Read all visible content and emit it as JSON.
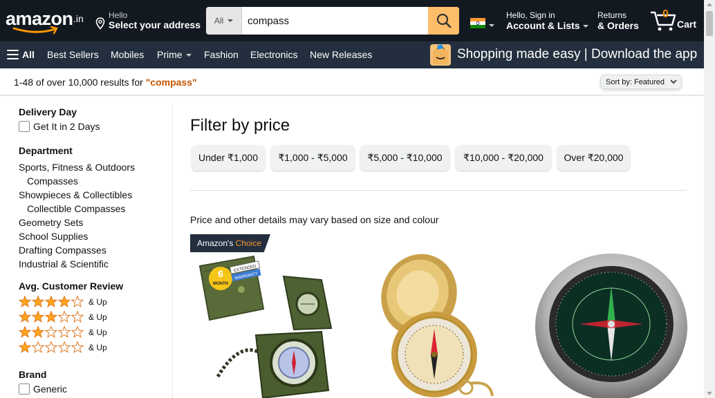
{
  "header": {
    "logo_text": "amazon",
    "logo_suffix": ".in",
    "address_hello": "Hello",
    "address_select": "Select your address",
    "search_category": "All",
    "search_value": "compass",
    "account_hello": "Hello, Sign in",
    "account_lists": "Account & Lists",
    "returns_line1": "Returns",
    "returns_line2": "& Orders",
    "cart_count": "0",
    "cart_label": "Cart",
    "flag": "india-flag-icon"
  },
  "nav": {
    "all": "All",
    "items": [
      "Best Sellers",
      "Mobiles",
      "Prime",
      "Fashion",
      "Electronics",
      "New Releases"
    ],
    "promo": "Shopping made easy | Download the app"
  },
  "results": {
    "prefix": "1-48 of over 10,000 results for ",
    "query": "\"compass\"",
    "sort_label": "Sort by:",
    "sort_value": "Featured"
  },
  "sidebar": {
    "delivery_heading": "Delivery Day",
    "delivery_option": "Get It in 2 Days",
    "department_heading": "Department",
    "departments": [
      "Sports, Fitness & Outdoors",
      "Compasses",
      "Showpieces & Collectibles",
      "Collectible Compasses",
      "Geometry Sets",
      "School Supplies",
      "Drafting Compasses",
      "Industrial & Scientific"
    ],
    "review_heading": "Avg. Customer Review",
    "review_up": "& Up",
    "review_levels": [
      4,
      3,
      2,
      1
    ],
    "brand_heading": "Brand",
    "brand_option": "Generic"
  },
  "main": {
    "filter_title": "Filter by price",
    "price_filters": [
      "Under ₹1,000",
      "₹1,000 - ₹5,000",
      "₹5,000 - ₹10,000",
      "₹10,000 - ₹20,000",
      "Over ₹20,000"
    ],
    "note": "Price and other details may vary based on size and colour",
    "choice_badge_a": "Amazon's",
    "choice_badge_b": "Choice",
    "warranty_top": "6",
    "warranty_month": "MONTH",
    "warranty_ext": "EXTENDED",
    "warranty_war": "WARRANTY"
  },
  "colors": {
    "top_bar": "#131921",
    "nav_bar": "#232f3e",
    "search_button": "#febd69",
    "cart_count": "#f08804",
    "query_color": "#c45500",
    "star": "#ffa41c"
  }
}
